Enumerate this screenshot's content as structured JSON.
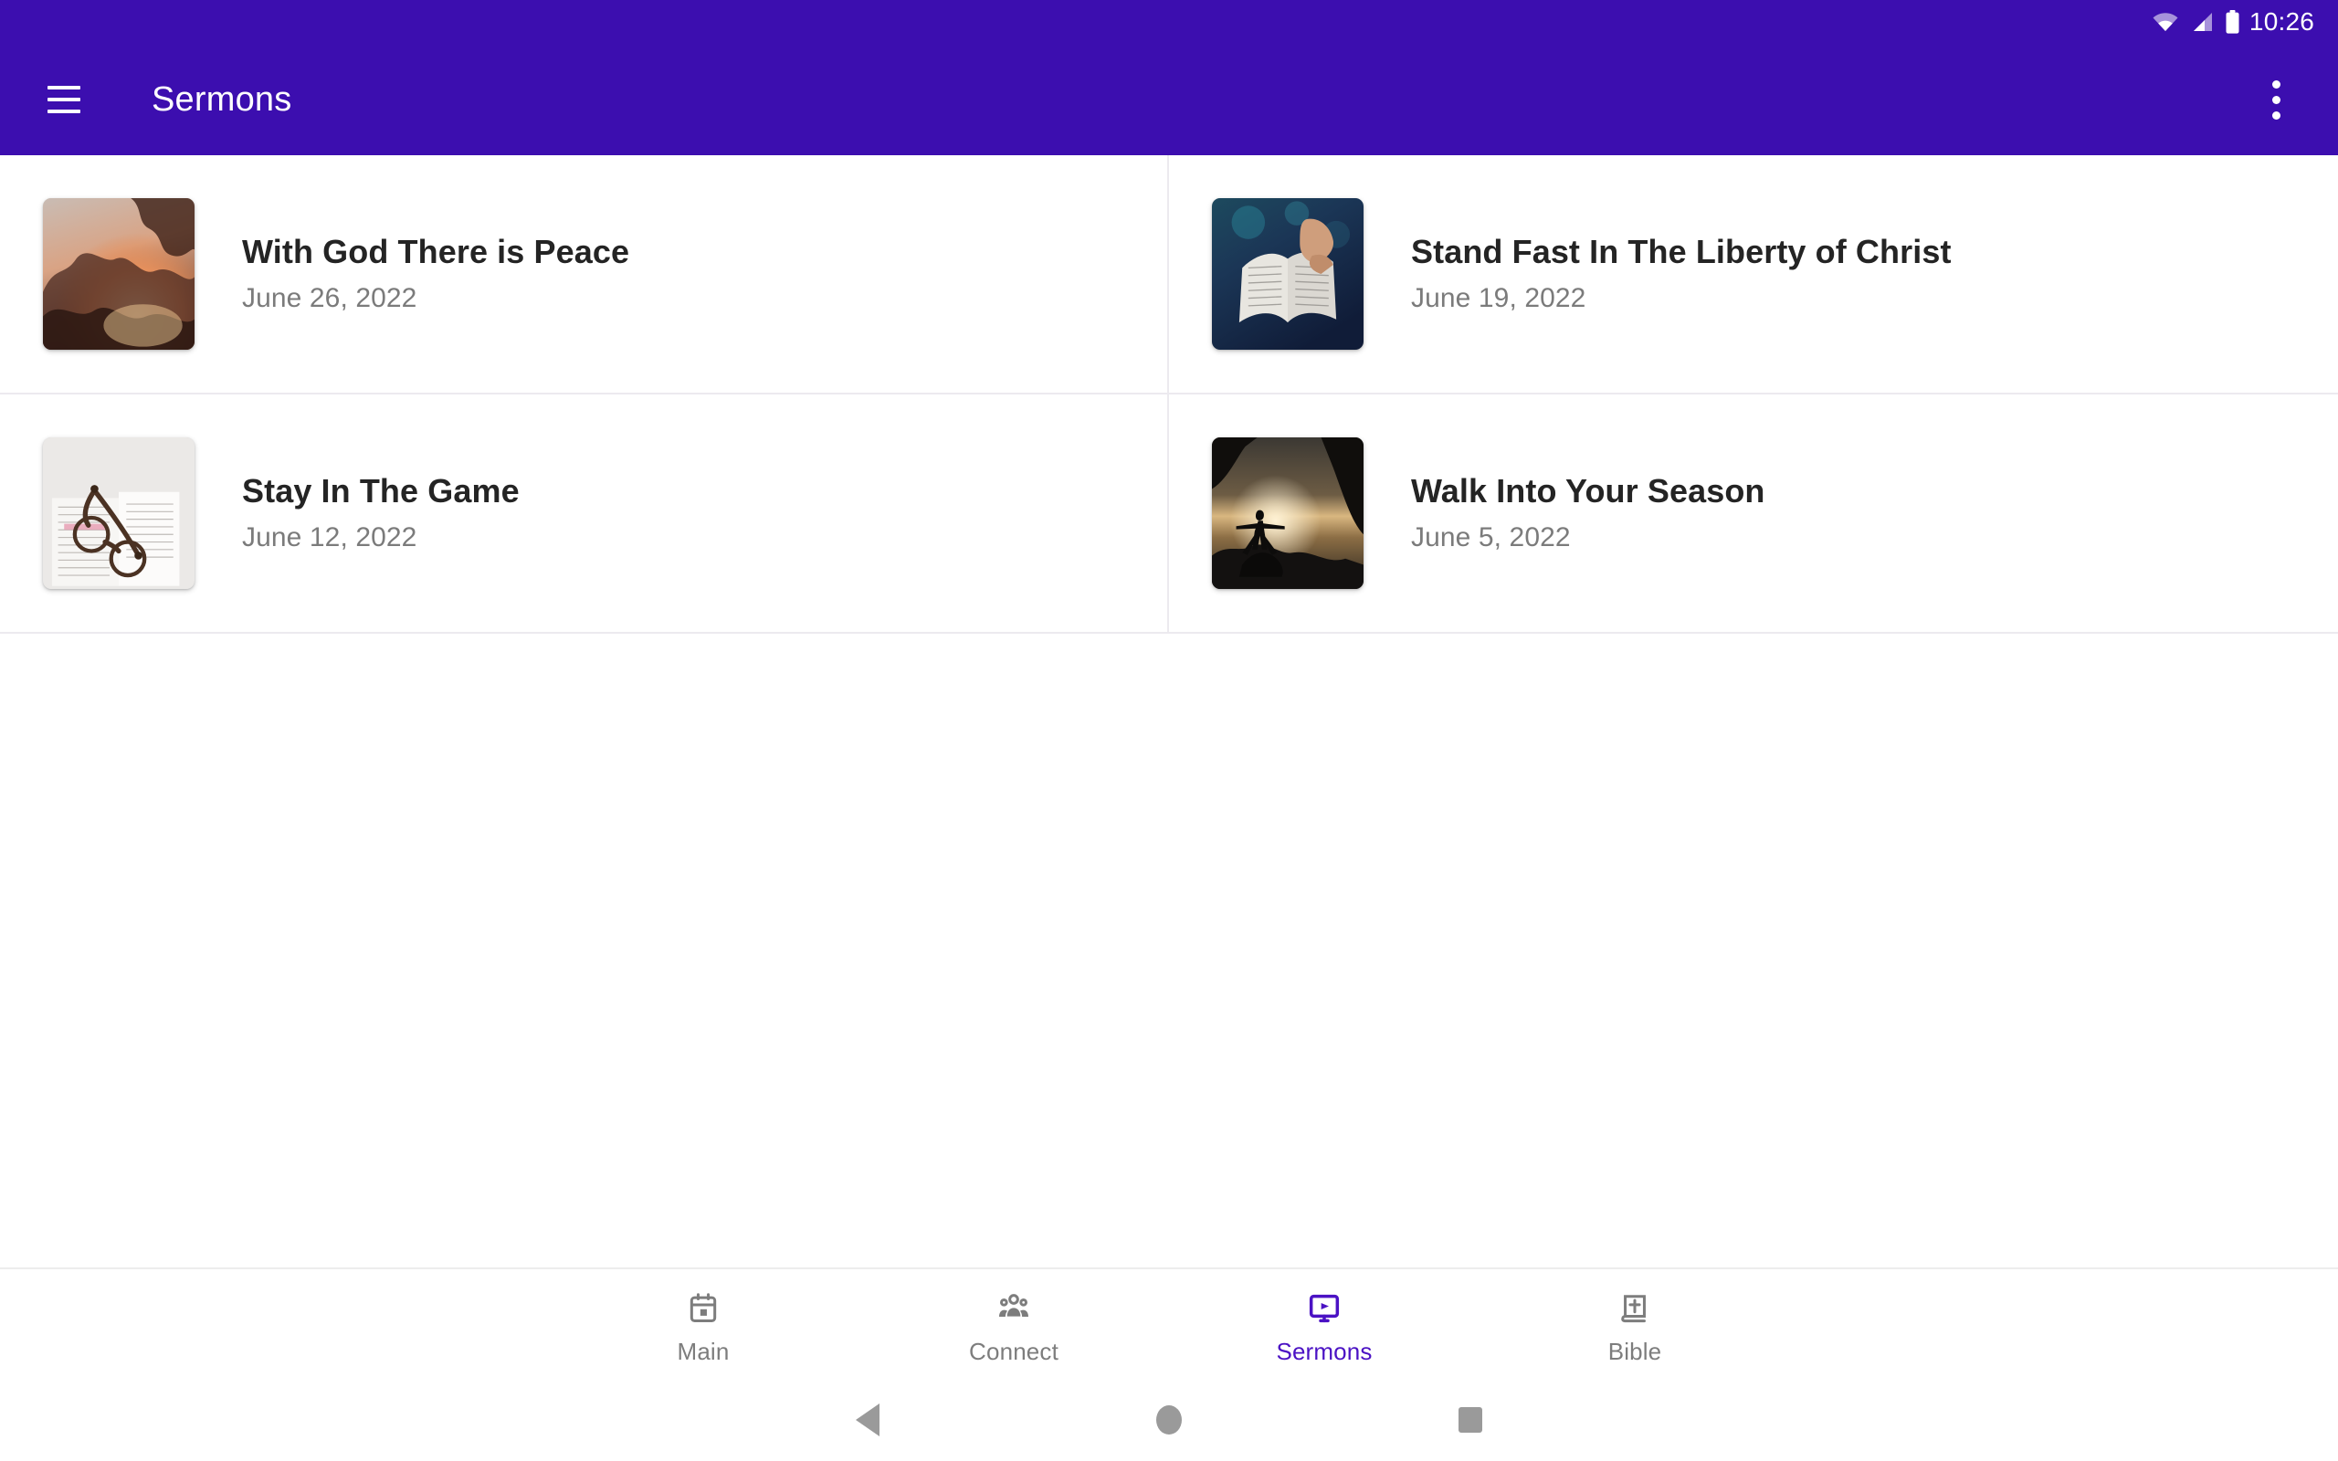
{
  "status_bar": {
    "time": "10:26",
    "icons": [
      "wifi-icon",
      "cellular-signal-icon",
      "battery-icon"
    ]
  },
  "app_bar": {
    "menu_icon": "hamburger-menu-icon",
    "title": "Sermons",
    "overflow_icon": "more-vertical-icon"
  },
  "sermons": [
    {
      "title": "With God There is Peace",
      "date": "June 26, 2022",
      "thumbnail": "orange-sunset-clouds"
    },
    {
      "title": "Stand Fast In The Liberty of Christ",
      "date": "June 19, 2022",
      "thumbnail": "open-bible-in-hands"
    },
    {
      "title": "Stay In The Game",
      "date": "June 12, 2022",
      "thumbnail": "glasses-on-open-book"
    },
    {
      "title": "Walk Into Your Season",
      "date": "June 5, 2022",
      "thumbnail": "silhouette-on-rock-at-sunset"
    }
  ],
  "bottom_nav": {
    "active_index": 2,
    "items": [
      {
        "label": "Main",
        "icon": "calendar-icon"
      },
      {
        "label": "Connect",
        "icon": "people-group-icon"
      },
      {
        "label": "Sermons",
        "icon": "video-play-monitor-icon"
      },
      {
        "label": "Bible",
        "icon": "book-with-cross-icon"
      }
    ]
  },
  "system_bar": {
    "back": "back-triangle-icon",
    "home": "home-circle-icon",
    "recents": "recents-square-icon"
  },
  "colors": {
    "primary": "#3C0EAF",
    "accent": "#4B12C4",
    "title_text": "#242424",
    "secondary_text": "#7b7b7b",
    "divider": "#eceaef"
  }
}
